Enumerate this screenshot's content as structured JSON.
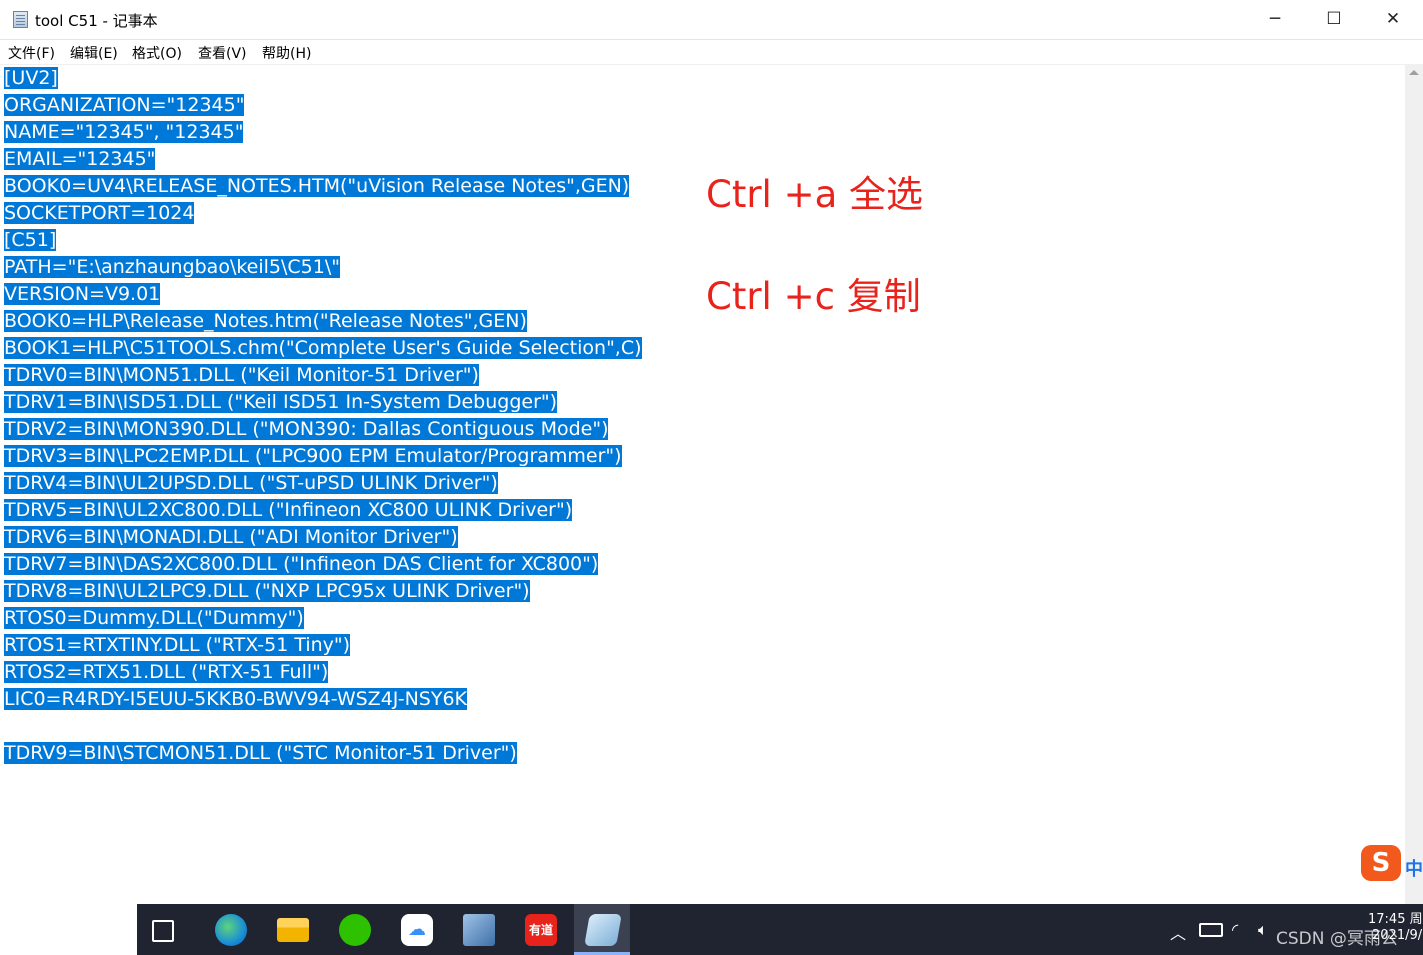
{
  "window": {
    "title": "tool C51 - 记事本",
    "minimize": "─",
    "maximize": "☐",
    "close": "✕"
  },
  "menu": [
    {
      "label": "文件(F)"
    },
    {
      "label": "编辑(E)"
    },
    {
      "label": "格式(O)"
    },
    {
      "label": "查看(V)"
    },
    {
      "label": "帮助(H)"
    }
  ],
  "editor": {
    "selected": true,
    "lines": [
      "[UV2]",
      "ORGANIZATION=\"12345\"",
      "NAME=\"12345\", \"12345\"",
      "EMAIL=\"12345\"",
      "BOOK0=UV4\\RELEASE_NOTES.HTM(\"uVision Release Notes\",GEN)",
      "SOCKETPORT=1024",
      "[C51]",
      "PATH=\"E:\\anzhaungbao\\keil5\\C51\\\"",
      "VERSION=V9.01",
      "BOOK0=HLP\\Release_Notes.htm(\"Release Notes\",GEN)",
      "BOOK1=HLP\\C51TOOLS.chm(\"Complete User's Guide Selection\",C)",
      "TDRV0=BIN\\MON51.DLL (\"Keil Monitor-51 Driver\")",
      "TDRV1=BIN\\ISD51.DLL (\"Keil ISD51 In-System Debugger\")",
      "TDRV2=BIN\\MON390.DLL (\"MON390: Dallas Contiguous Mode\")",
      "TDRV3=BIN\\LPC2EMP.DLL (\"LPC900 EPM Emulator/Programmer\")",
      "TDRV4=BIN\\UL2UPSD.DLL (\"ST-uPSD ULINK Driver\")",
      "TDRV5=BIN\\UL2XC800.DLL (\"Infineon XC800 ULINK Driver\")",
      "TDRV6=BIN\\MONADI.DLL (\"ADI Monitor Driver\")",
      "TDRV7=BIN\\DAS2XC800.DLL (\"Infineon DAS Client for XC800\")",
      "TDRV8=BIN\\UL2LPC9.DLL (\"NXP LPC95x ULINK Driver\")",
      "RTOS0=Dummy.DLL(\"Dummy\")",
      "RTOS1=RTXTINY.DLL (\"RTX-51 Tiny\")",
      "RTOS2=RTX51.DLL (\"RTX-51 Full\")",
      "LIC0=R4RDY-I5EUU-5KKB0-BWV94-WSZ4J-NSY6K",
      "",
      "TDRV9=BIN\\STCMON51.DLL (\"STC Monitor-51 Driver\")"
    ]
  },
  "annotations": {
    "select_all": "Ctrl +a 全选",
    "copy": "Ctrl +c 复制"
  },
  "ime": {
    "logo": "S",
    "mode": "中"
  },
  "taskbar": {
    "apps": [
      {
        "name": "task-view-icon",
        "label": ""
      },
      {
        "name": "edge-icon",
        "label": ""
      },
      {
        "name": "file-explorer-icon",
        "label": ""
      },
      {
        "name": "wechat-icon",
        "label": ""
      },
      {
        "name": "baidu-netdisk-icon",
        "label": ""
      },
      {
        "name": "tool-app-icon",
        "label": ""
      },
      {
        "name": "youdao-icon",
        "label": "有道"
      },
      {
        "name": "notepad-taskbar-icon",
        "label": ""
      }
    ],
    "clock_time": "17:45 周",
    "clock_date": "2021/9/",
    "watermark": "CSDN @冥雨公"
  },
  "colors": {
    "selection": "#0078d7",
    "annotation": "#e8231c"
  }
}
